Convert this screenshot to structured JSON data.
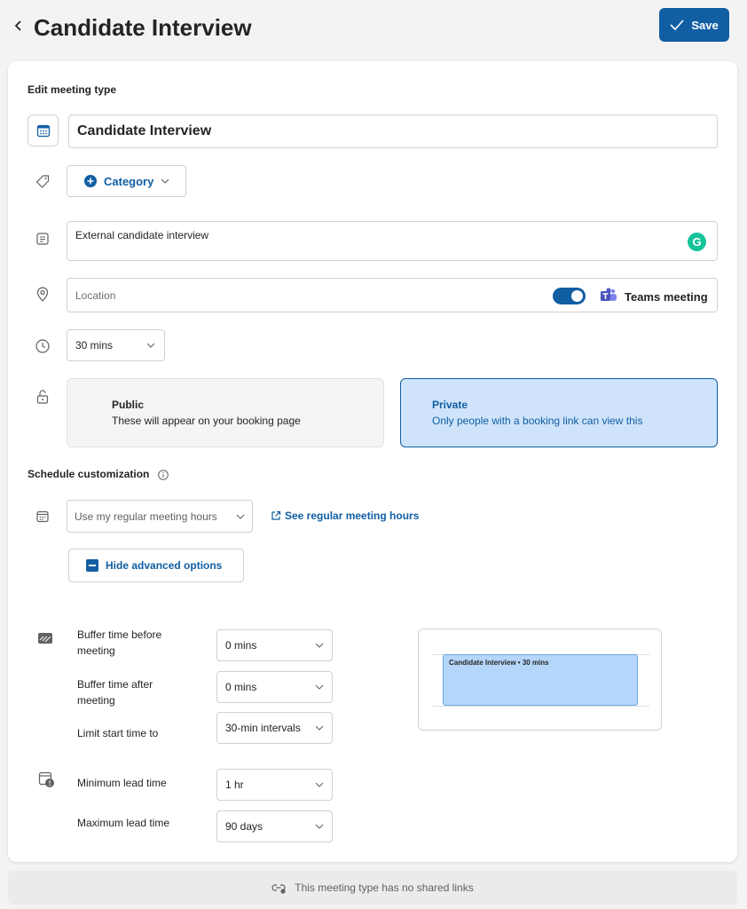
{
  "header": {
    "back_icon": "chevron-left-icon",
    "title": "Candidate Interview",
    "save_label": "Save",
    "save_icon": "checkmark-icon"
  },
  "form": {
    "section_title": "Edit meeting type",
    "title_value": "Candidate Interview",
    "category_label": "Category",
    "description_value": "External candidate interview",
    "location_placeholder": "Location",
    "teams_toggle_on": true,
    "teams_label": "Teams meeting",
    "duration_value": "30 mins",
    "visibility": {
      "public": {
        "title": "Public",
        "description": "These will appear on your booking page",
        "selected": false
      },
      "private": {
        "title": "Private",
        "description": "Only people with a booking link can view this",
        "selected": true
      }
    }
  },
  "schedule": {
    "section_title": "Schedule customization",
    "hours_value": "Use my regular meeting hours",
    "see_hours_link": "See regular meeting hours",
    "advanced_toggle_label": "Hide advanced options",
    "buffer_before_label": "Buffer time before meeting",
    "buffer_before_value": "0 mins",
    "buffer_after_label": "Buffer time after meeting",
    "buffer_after_value": "0 mins",
    "limit_start_label": "Limit start time to",
    "limit_start_value": "30-min intervals",
    "min_lead_label": "Minimum lead time",
    "min_lead_value": "1 hr",
    "max_lead_label": "Maximum lead time",
    "max_lead_value": "90 days",
    "preview_event": "Candidate Interview • 30 mins"
  },
  "footer": {
    "text": "This meeting type has no shared links"
  },
  "colors": {
    "accent": "#115ea3",
    "private_bg": "#cfe4fa",
    "grammarly": "#15c39a"
  }
}
